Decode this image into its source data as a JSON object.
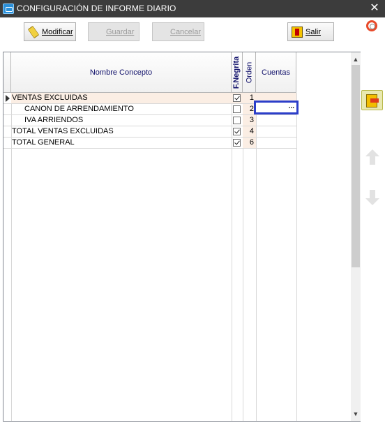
{
  "window": {
    "title": "CONFIGURACIÓN DE INFORME DIARIO",
    "close_glyph": "✕"
  },
  "toolbar": {
    "modificar_label": "Modificar",
    "guardar_label": "Guardar",
    "cancelar_label": "Cancelar",
    "salir_label": "Salir"
  },
  "grid": {
    "headers": {
      "nombre": "Nombre Concepto",
      "negrita": "F.Negrita",
      "orden": "Orden",
      "cuentas": "Cuentas"
    },
    "rows": [
      {
        "nombre": "VENTAS EXCLUIDAS",
        "negrita": true,
        "orden": "1",
        "cuentas": "",
        "indent": false,
        "current": true
      },
      {
        "nombre": "CANON DE ARRENDAMIENTO",
        "negrita": false,
        "orden": "2",
        "cuentas": "",
        "indent": true,
        "current": false
      },
      {
        "nombre": "IVA ARRIENDOS",
        "negrita": false,
        "orden": "3",
        "cuentas": "",
        "indent": true,
        "current": false
      },
      {
        "nombre": "TOTAL VENTAS EXCLUIDAS",
        "negrita": true,
        "orden": "4",
        "cuentas": "",
        "indent": false,
        "current": false
      },
      {
        "nombre": "TOTAL GENERAL",
        "negrita": true,
        "orden": "6",
        "cuentas": "",
        "indent": false,
        "current": false
      }
    ],
    "ellipsis": "...",
    "scroll_up": "▲",
    "scroll_down": "▼"
  },
  "colors": {
    "titlebar": "#3c3c3c",
    "selection_highlight": "#2c3ec9",
    "order_cell_bg": "#fbeee4"
  },
  "icons": {
    "app": "form-icon",
    "modificar": "pencil-icon",
    "salir": "exit-door-icon",
    "help": "lifebuoy-icon",
    "side": "exit-door-icon",
    "move_up": "arrow-up-icon",
    "move_down": "arrow-down-icon"
  }
}
